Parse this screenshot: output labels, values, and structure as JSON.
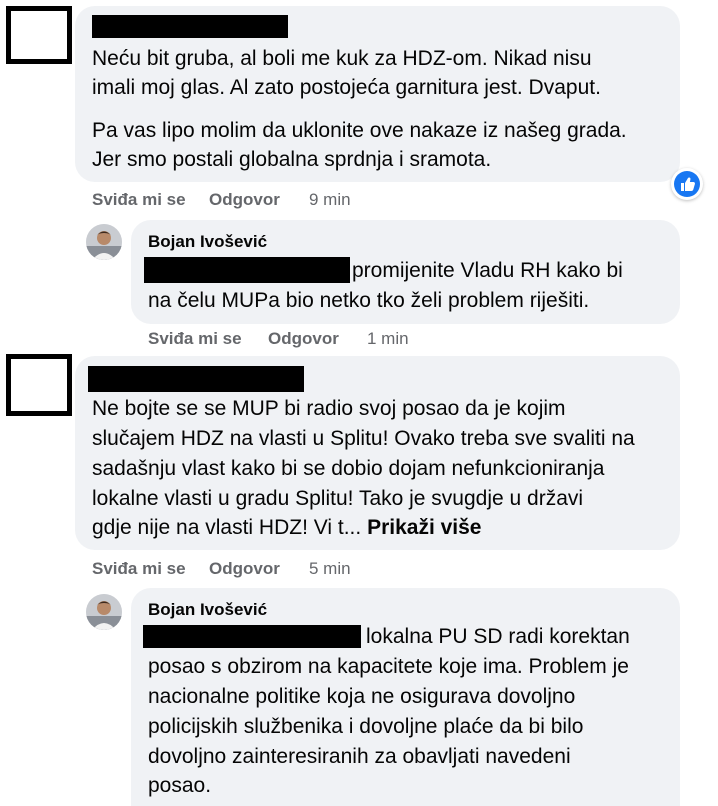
{
  "comments": [
    {
      "id": "c1",
      "paragraphs": [
        [
          "Neću bit gruba, al boli me kuk za HDZ-om. Nikad nisu",
          "imali moj glas. Al zato postojeća garnitura jest. Dvaput."
        ],
        [
          "Pa vas lipo molim da uklonite ove nakaze iz našeg grada.",
          "Jer smo postali globalna sprdnja i sramota."
        ]
      ],
      "actions": {
        "like": "Sviđa mi se",
        "reply": "Odgovor",
        "time": "9 min"
      },
      "reaction": "like-icon",
      "reply": {
        "author": "Bojan Ivošević",
        "lines": [
          "promijenite Vladu RH kako bi",
          "na čelu MUPa bio netko tko želi problem riješiti."
        ],
        "actions": {
          "like": "Sviđa mi se",
          "reply": "Odgovor",
          "time": "1 min"
        }
      }
    },
    {
      "id": "c2",
      "lines": [
        "Ne bojte se se MUP bi radio svoj posao da je kojim",
        "slučajem HDZ na vlasti u Splitu! Ovako treba sve svaliti na",
        "sadašnju vlast kako bi se dobio dojam nefunkcioniranja",
        "lokalne vlasti u gradu Splitu! Tako je svugdje u državi",
        "gdje nije na vlasti HDZ! Vi t..."
      ],
      "see_more": "Prikaži više",
      "actions": {
        "like": "Sviđa mi se",
        "reply": "Odgovor",
        "time": "5 min"
      },
      "reply": {
        "author": "Bojan Ivošević",
        "lines": [
          "lokalna PU SD radi korektan",
          "posao s obzirom na kapacitete koje ima. Problem je",
          "nacionalne politike koja ne osigurava dovoljno",
          "policijskih službenika i dovoljne plaće da bi bilo",
          "dovoljno zainteresiranih za obavljati navedeni",
          "posao."
        ]
      }
    }
  ],
  "colors": {
    "bubble": "#f0f2f5",
    "text": "#050505",
    "meta": "#65676b",
    "like": "#1877f2"
  }
}
